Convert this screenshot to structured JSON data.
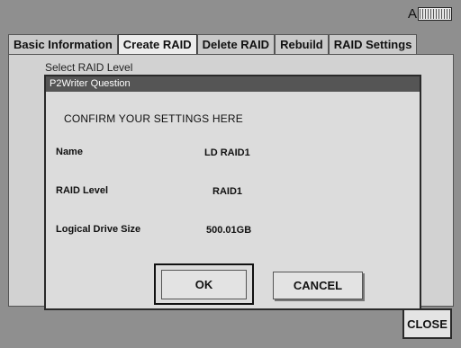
{
  "status": {
    "indicator_letter": "A",
    "icon": "battery-icon"
  },
  "tabs": [
    {
      "label": "Basic Information",
      "active": false
    },
    {
      "label": "Create RAID",
      "active": true
    },
    {
      "label": "Delete RAID",
      "active": false
    },
    {
      "label": "Rebuild",
      "active": false
    },
    {
      "label": "RAID Settings",
      "active": false
    }
  ],
  "panel": {
    "partial_label": "Select RAID Level"
  },
  "dialog": {
    "title": "P2Writer Question",
    "heading": "CONFIRM YOUR SETTINGS HERE",
    "rows": [
      {
        "label": "Name",
        "value": "LD RAID1"
      },
      {
        "label": "RAID Level",
        "value": "RAID1"
      },
      {
        "label": "Logical Drive Size",
        "value": "500.01GB"
      }
    ],
    "ok_label": "OK",
    "cancel_label": "CANCEL"
  },
  "close_label": "CLOSE"
}
